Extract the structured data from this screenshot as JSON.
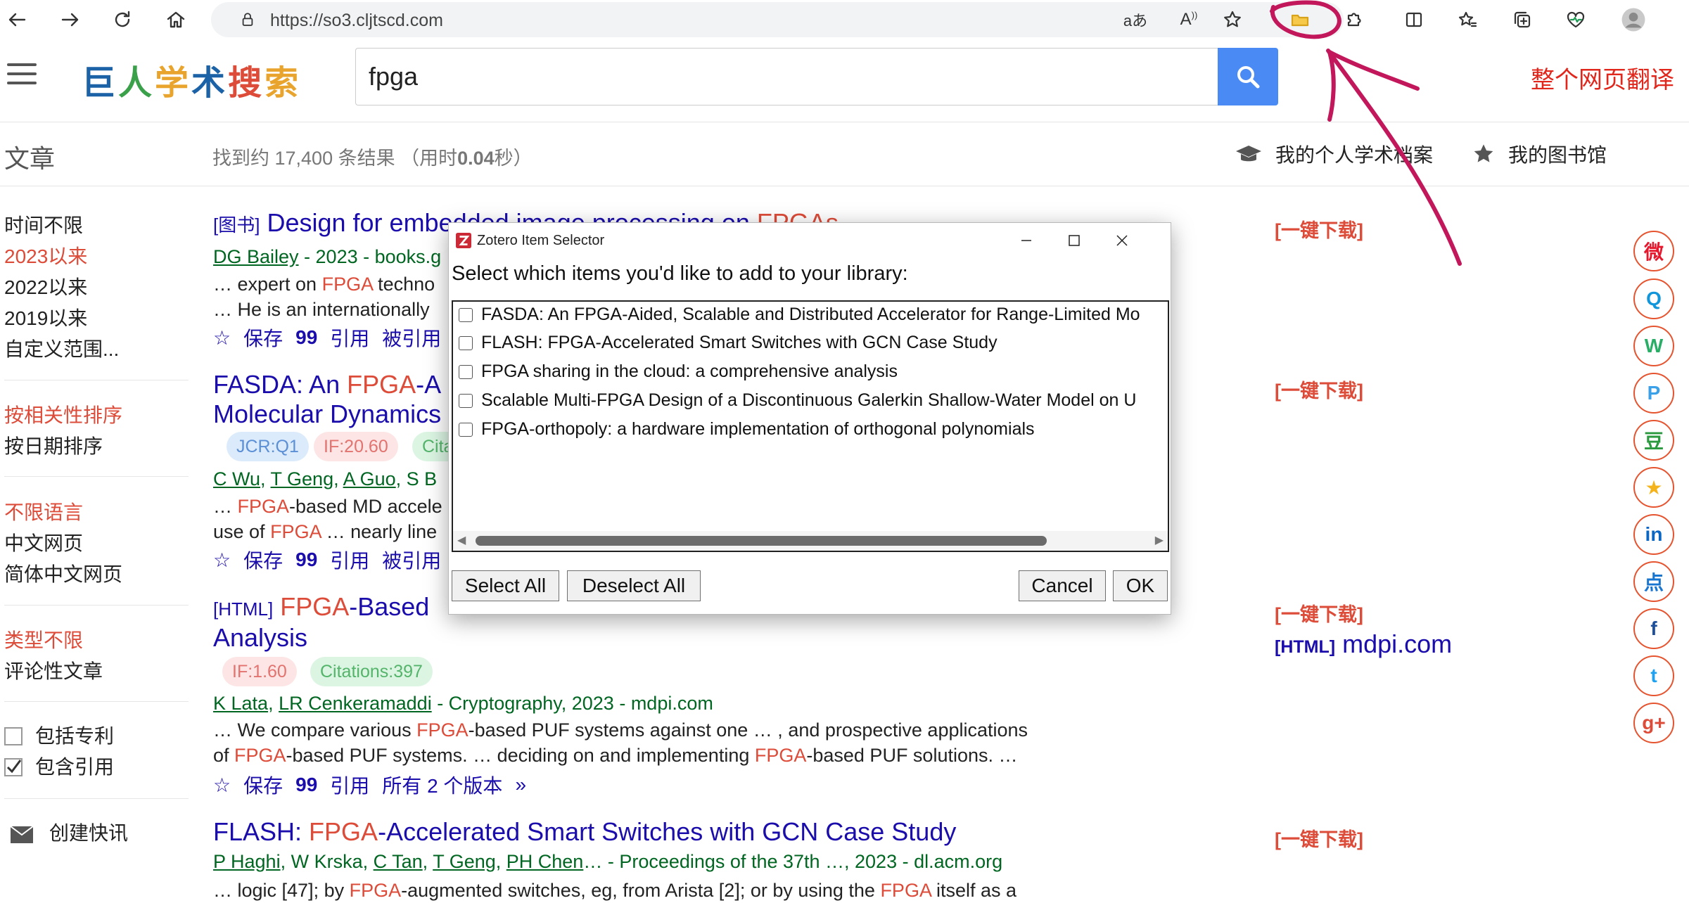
{
  "browser": {
    "url": "https://so3.cljtscd.com"
  },
  "header": {
    "logo_chars": [
      "巨",
      "人",
      "学",
      "术",
      "搜",
      "索"
    ],
    "logo_colors": [
      "#1b62a6",
      "#3aa14a",
      "#e8a42c",
      "#1b62a6",
      "#dd4b39",
      "#e8a42c"
    ],
    "search_value": "fpga",
    "translate": "整个网页翻译"
  },
  "subheader": {
    "section": "文章",
    "stats_prefix": "找到约 17,400 条结果 （用时",
    "stats_time": "0.04",
    "stats_suffix": "秒）",
    "profile": "我的个人学术档案",
    "library": "我的图书馆"
  },
  "sidebar": {
    "time": [
      "时间不限",
      "2023以来",
      "2022以来",
      "2019以来",
      "自定义范围..."
    ],
    "sort": [
      "按相关性排序",
      "按日期排序"
    ],
    "lang": [
      "不限语言",
      "中文网页",
      "简体中文网页"
    ],
    "type": [
      "类型不限",
      "评论性文章"
    ],
    "patents": "包括专利",
    "citations": "包含引用",
    "alert": "创建快讯"
  },
  "results": {
    "r1": {
      "tag": "[图书]",
      "title_a": "Design for embedded image processing on ",
      "title_hl": "FPGAs",
      "authors_u": "DG Bailey",
      "authors_rest": " - 2023 - books.g",
      "snip1_a": "… expert on ",
      "snip1_hl": "FPGA",
      "snip1_b": " techno",
      "snip2": "… He is an internationally",
      "save": "保存",
      "cite": "引用",
      "cited": "被引用"
    },
    "r2": {
      "title1_a": "FASDA: An ",
      "title1_hl": "FPGA",
      "title1_b": "-A",
      "title2": "Molecular Dynamics",
      "jcr": "JCR:Q1",
      "if": "IF:20.60",
      "cit": "Cita",
      "authors_u": [
        "C Wu",
        "T Geng",
        "A Guo"
      ],
      "authors_rest": ", S B",
      "snip1_a": "… ",
      "snip1_hl": "FPGA",
      "snip1_b": "-based MD accele",
      "snip2_a": "use of ",
      "snip2_hl": "FPGA",
      "snip2_b": " … nearly line",
      "save": "保存",
      "cite": "引用",
      "cited": "被引用"
    },
    "r3": {
      "tag": "[HTML]",
      "title1_hl": "FPGA",
      "title1_b": "-Based ",
      "title2": "Analysis",
      "if": "IF:1.60",
      "cit": "Citations:397",
      "authors_u": [
        "K Lata",
        "LR Cenkeramaddi"
      ],
      "authors_rest": " - Cryptography, 2023 - mdpi.com",
      "snip1_a": "… We compare various ",
      "snip1_hl": "FPGA",
      "snip1_b": "-based PUF systems against one … , and prospective applications",
      "snip2_a": "of ",
      "snip2_hl": "FPGA",
      "snip2_b": "-based PUF systems. … deciding on and implementing ",
      "snip2_hl2": "FPGA",
      "snip2_c": "-based PUF solutions. …",
      "save": "保存",
      "cite": "引用",
      "versions": "所有 2 个版本"
    },
    "r4": {
      "title_a": "FLASH: ",
      "title_hl": "FPGA",
      "title_b": "-Accelerated Smart Switches with GCN Case Study",
      "authors_u": [
        "P Haghi",
        "C Tan",
        "T Geng",
        "PH Chen"
      ],
      "authors_plain1": "W Krska",
      "authors_rest": "… - Proceedings of the 37th …, 2023 - dl.acm.org",
      "snip1_a": "… logic [47]; by ",
      "snip1_hl": "FPGA",
      "snip1_b": "-augmented switches, eg, from Arista [2]; or by using the ",
      "snip1_hl2": "FPGA",
      "snip1_c": " itself as a"
    }
  },
  "right": {
    "download": "[一键下载]",
    "html_tag": "[HTML]",
    "html_site": "mdpi.com"
  },
  "share": [
    "weibo",
    "qq",
    "wechat",
    "pinterest",
    "douban",
    "qzone",
    "linkedin",
    "dianping",
    "facebook",
    "twitter",
    "google-plus"
  ],
  "dialog": {
    "title": "Zotero Item Selector",
    "prompt": "Select which items you'd like to add to your library:",
    "items": [
      "FASDA: An FPGA-Aided, Scalable and Distributed Accelerator for Range-Limited Mo",
      "FLASH: FPGA-Accelerated Smart Switches with GCN Case Study",
      "FPGA sharing in the cloud: a comprehensive analysis",
      "Scalable Multi-FPGA Design of a Discontinuous Galerkin Shallow-Water Model on U",
      "FPGA-orthopoly: a hardware implementation of orthogonal polynomials"
    ],
    "select_all": "Select All",
    "deselect_all": "Deselect All",
    "cancel": "Cancel",
    "ok": "OK"
  },
  "colors": {
    "link_blue": "#1a0dab",
    "highlight_red": "#dd4b39",
    "author_green": "#006621",
    "search_blue": "#4a8af4",
    "annotation": "#c2185b"
  }
}
